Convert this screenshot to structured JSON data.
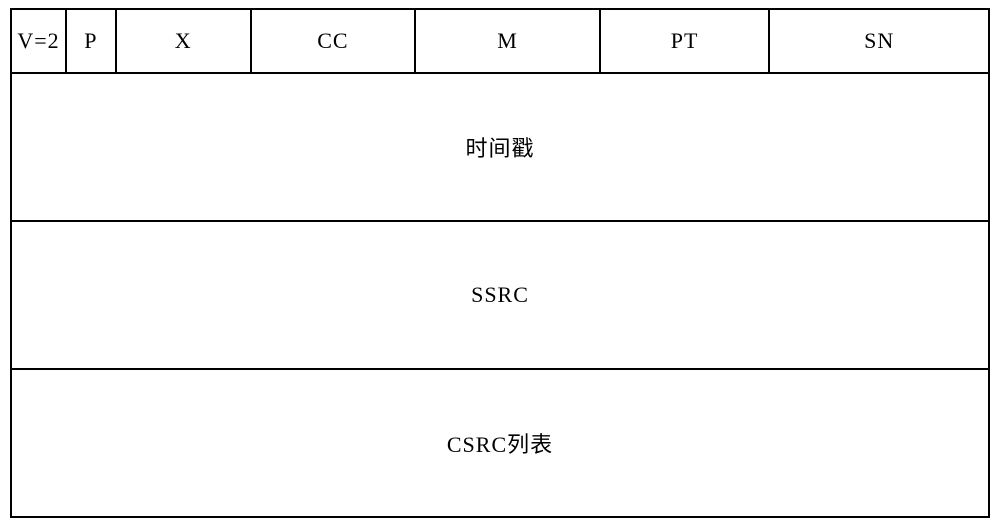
{
  "header": {
    "version": "V=2",
    "padding": "P",
    "extension": "X",
    "csrc_count": "CC",
    "marker": "M",
    "payload_type": "PT",
    "sequence_number": "SN"
  },
  "rows": {
    "timestamp": "时间戳",
    "ssrc": "SSRC",
    "csrc_list": "CSRC列表"
  }
}
